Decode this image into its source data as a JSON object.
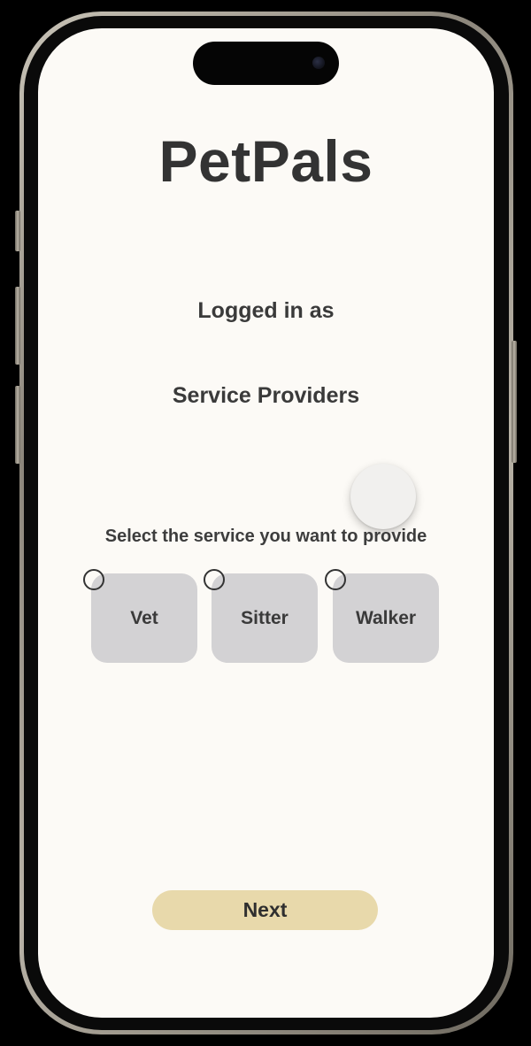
{
  "app": {
    "title": "PetPals"
  },
  "login": {
    "logged_in_label": "Logged in as",
    "role": "Service Providers"
  },
  "toggle": {
    "state": "on"
  },
  "service_selection": {
    "prompt": "Select the service you want to provide",
    "options": [
      {
        "label": "Vet",
        "selected": false
      },
      {
        "label": "Sitter",
        "selected": false
      },
      {
        "label": "Walker",
        "selected": false
      }
    ]
  },
  "actions": {
    "next_label": "Next"
  },
  "colors": {
    "screen_background": "#fcfaf6",
    "card_background": "#d3d2d4",
    "next_button": "#e8d9ab",
    "text_primary": "#333333"
  }
}
